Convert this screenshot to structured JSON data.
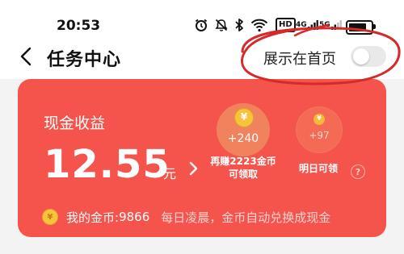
{
  "status_bar": {
    "time": "20:53",
    "icons": [
      "alarm-icon",
      "mute-icon",
      "bluetooth-icon",
      "wifi-icon",
      "hd-icon",
      "signal-4g-icon",
      "signal-5g-icon",
      "battery-icon"
    ],
    "hd_label": "HD",
    "net1_label": "4G",
    "net2_label": "5G"
  },
  "header": {
    "title": "任务中心",
    "toggle_label": "展示在首页",
    "toggle_on": false
  },
  "card": {
    "label": "现金收益",
    "amount": "12.55",
    "unit": "元",
    "earn_more_coin": "+240",
    "earn_more_caption_line1": "再赚2223金币",
    "earn_more_caption_line2": "可领取",
    "tomorrow_coin": "+97",
    "tomorrow_caption": "明日可领",
    "my_coins_label": "我的金币:",
    "my_coins_value": "9866",
    "exchange_note": "每日凌晨，金币自动兑换成现金"
  },
  "colors": {
    "card_bg": "#f5544c",
    "annotation_red": "#d42a2a",
    "coin_gold": "#f7c23d"
  }
}
